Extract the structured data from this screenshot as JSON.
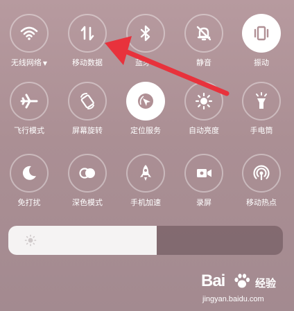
{
  "tiles": [
    {
      "label": "无线网络",
      "caret": "▼",
      "icon": "wifi-icon",
      "active": false
    },
    {
      "label": "移动数据",
      "icon": "mobile-data-icon",
      "active": false
    },
    {
      "label": "蓝牙",
      "caret": "▼",
      "icon": "bluetooth-icon",
      "active": false
    },
    {
      "label": "静音",
      "icon": "mute-bell-icon",
      "active": false
    },
    {
      "label": "振动",
      "icon": "vibrate-icon",
      "active": true
    },
    {
      "label": "飞行模式",
      "icon": "airplane-icon",
      "active": false
    },
    {
      "label": "屏幕旋转",
      "icon": "screen-rotation-icon",
      "active": false
    },
    {
      "label": "定位服务",
      "icon": "location-icon",
      "active": true
    },
    {
      "label": "自动亮度",
      "icon": "auto-brightness-icon",
      "active": false
    },
    {
      "label": "手电筒",
      "icon": "flashlight-icon",
      "active": false
    },
    {
      "label": "免打扰",
      "icon": "moon-icon",
      "active": false
    },
    {
      "label": "深色模式",
      "icon": "dark-mode-icon",
      "active": false
    },
    {
      "label": "手机加速",
      "icon": "rocket-icon",
      "active": false
    },
    {
      "label": "录屏",
      "icon": "screen-record-icon",
      "active": false
    },
    {
      "label": "移动热点",
      "icon": "hotspot-icon",
      "active": false
    }
  ],
  "brightness": {
    "level": 0.54,
    "icon": "brightness-low-icon"
  },
  "annotation": {
    "color": "#e8323c",
    "type": "arrow",
    "points_to": "移动数据"
  },
  "watermark": {
    "logo": "Bai",
    "brand": "经验",
    "url": "jingyan.baidu.com"
  },
  "colors": {
    "active_bg": "#ffffff",
    "active_icon": "#b09095",
    "inactive_icon": "#ffffff"
  }
}
